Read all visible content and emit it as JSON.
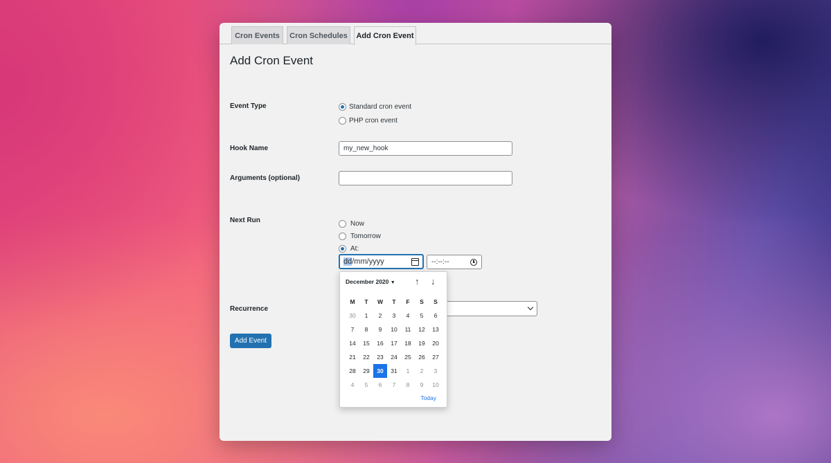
{
  "tabs": [
    {
      "label": "Cron Events"
    },
    {
      "label": "Cron Schedules"
    },
    {
      "label": "Add Cron Event"
    }
  ],
  "page_title": "Add Cron Event",
  "form": {
    "event_type": {
      "label": "Event Type",
      "options": [
        {
          "label": "Standard cron event",
          "checked": true
        },
        {
          "label": "PHP cron event",
          "checked": false
        }
      ]
    },
    "hook_name": {
      "label": "Hook Name",
      "value": "my_new_hook"
    },
    "arguments": {
      "label": "Arguments (optional)",
      "value": ""
    },
    "next_run": {
      "label": "Next Run",
      "options": [
        {
          "label": "Now",
          "checked": false
        },
        {
          "label": "Tomorrow",
          "checked": false
        },
        {
          "label": "At:",
          "checked": true
        }
      ],
      "date_field": {
        "highlighted": "dd",
        "rest": "/mm/yyyy"
      },
      "time_field": "--:--:--"
    },
    "recurrence": {
      "label": "Recurrence",
      "value": ""
    },
    "submit_label": "Add Event"
  },
  "date_picker": {
    "month_label": "December 2020",
    "weekday_headers": [
      "M",
      "T",
      "W",
      "T",
      "F",
      "S",
      "S"
    ],
    "weeks": [
      [
        {
          "d": "30",
          "muted": true
        },
        {
          "d": "1"
        },
        {
          "d": "2"
        },
        {
          "d": "3"
        },
        {
          "d": "4"
        },
        {
          "d": "5"
        },
        {
          "d": "6"
        }
      ],
      [
        {
          "d": "7"
        },
        {
          "d": "8"
        },
        {
          "d": "9"
        },
        {
          "d": "10"
        },
        {
          "d": "11"
        },
        {
          "d": "12"
        },
        {
          "d": "13"
        }
      ],
      [
        {
          "d": "14"
        },
        {
          "d": "15"
        },
        {
          "d": "16"
        },
        {
          "d": "17"
        },
        {
          "d": "18"
        },
        {
          "d": "19"
        },
        {
          "d": "20"
        }
      ],
      [
        {
          "d": "21"
        },
        {
          "d": "22"
        },
        {
          "d": "23"
        },
        {
          "d": "24"
        },
        {
          "d": "25"
        },
        {
          "d": "26"
        },
        {
          "d": "27"
        }
      ],
      [
        {
          "d": "28"
        },
        {
          "d": "29"
        },
        {
          "d": "30",
          "selected": true
        },
        {
          "d": "31"
        },
        {
          "d": "1",
          "muted": true
        },
        {
          "d": "2",
          "muted": true
        },
        {
          "d": "3",
          "muted": true
        }
      ],
      [
        {
          "d": "4",
          "muted": true
        },
        {
          "d": "5",
          "muted": true
        },
        {
          "d": "6",
          "muted": true
        },
        {
          "d": "7",
          "muted": true
        },
        {
          "d": "8",
          "muted": true
        },
        {
          "d": "9",
          "muted": true
        },
        {
          "d": "10",
          "muted": true
        }
      ]
    ],
    "today_label": "Today"
  },
  "colors": {
    "accent": "#2271b1",
    "picker_selected": "#1a73e8"
  }
}
